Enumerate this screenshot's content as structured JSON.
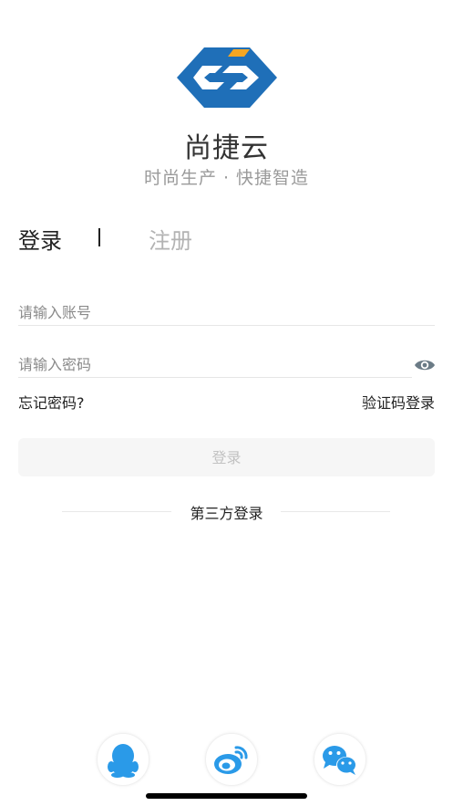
{
  "brand": {
    "name": "尚捷云",
    "tagline": "时尚生产 · 快捷智造",
    "logo_colors": {
      "primary": "#1f6fb8",
      "accent": "#f5a623"
    }
  },
  "tabs": {
    "login": "登录",
    "register": "注册"
  },
  "form": {
    "account_placeholder": "请输入账号",
    "password_placeholder": "请输入密码",
    "forgot_password": "忘记密码?",
    "code_login": "验证码登录",
    "submit": "登录"
  },
  "third_party": {
    "title": "第三方登录",
    "icons": [
      "qq-icon",
      "weibo-icon",
      "wechat-icon"
    ]
  },
  "colors": {
    "text_primary": "#222222",
    "text_muted": "#9a9a9a",
    "button_bg": "#f6f6f6",
    "button_text": "#c2c2c2",
    "social_blue": "#2a9ae8"
  }
}
